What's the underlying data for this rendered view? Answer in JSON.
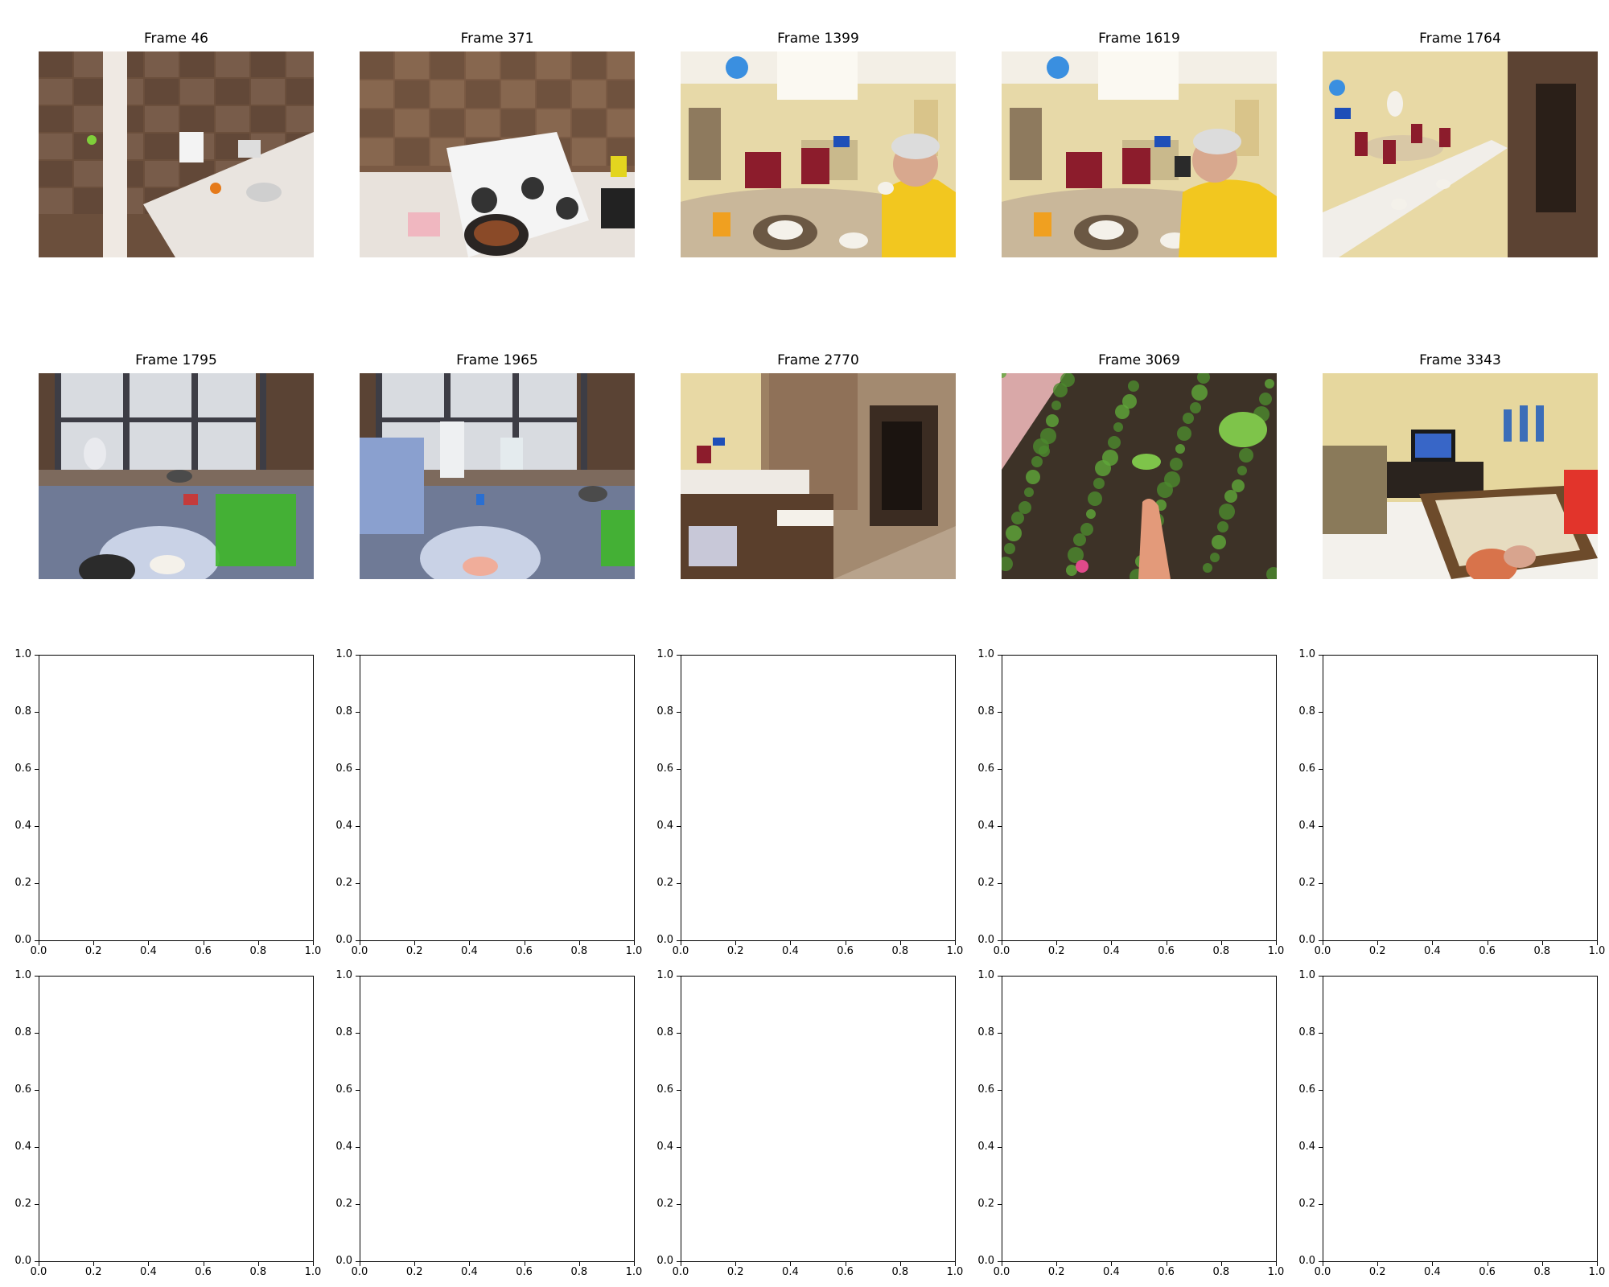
{
  "frames": [
    {
      "title": "Frame 46",
      "scene": "kitchen-counter"
    },
    {
      "title": "Frame 371",
      "scene": "stove-cooking"
    },
    {
      "title": "Frame 1399",
      "scene": "dining-man-drinking"
    },
    {
      "title": "Frame 1619",
      "scene": "dining-man-drinking-2"
    },
    {
      "title": "Frame 1764",
      "scene": "dining-room-counter"
    },
    {
      "title": "Frame 1795",
      "scene": "sink-window"
    },
    {
      "title": "Frame 1965",
      "scene": "sink-window-2"
    },
    {
      "title": "Frame 2770",
      "scene": "kitchen-doorway"
    },
    {
      "title": "Frame 3069",
      "scene": "garden-soil"
    },
    {
      "title": "Frame 3343",
      "scene": "living-room-tv"
    }
  ],
  "empty_axes": {
    "x_ticks": [
      "0.0",
      "0.2",
      "0.4",
      "0.6",
      "0.8",
      "1.0"
    ],
    "y_ticks": [
      "0.0",
      "0.2",
      "0.4",
      "0.6",
      "0.8",
      "1.0"
    ],
    "count": 10
  }
}
